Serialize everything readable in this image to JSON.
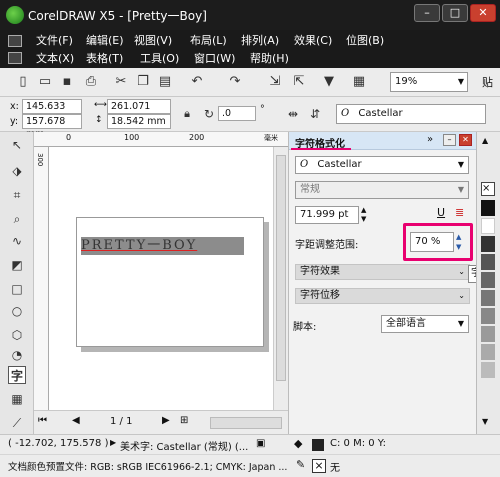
{
  "window": {
    "title": "CorelDRAW X5 - [Pretty一Boy]",
    "min": "–",
    "max": "□",
    "close": "✕"
  },
  "menu": {
    "row1": [
      "文件(F)",
      "编辑(E)",
      "视图(V)",
      "布局(L)",
      "排列(A)",
      "效果(C)",
      "位图(B)"
    ],
    "row2": [
      "文本(X)",
      "表格(T)",
      "工具(O)",
      "窗口(W)",
      "帮助(H)"
    ]
  },
  "toolbar": {
    "zoom": "19%",
    "paste_label": "贴"
  },
  "property_bar": {
    "x": "x:",
    "y": "y:",
    "x_value": "145.633 mm",
    "y_value": "157.678 mm",
    "w_value": "261.071 mm",
    "h_value": "18.542 mm",
    "angle": ".0",
    "degree": "°",
    "font": "Castellar"
  },
  "ruler": {
    "t0": "0",
    "t100": "100",
    "t200": "200",
    "unit": "毫米",
    "l300": "300"
  },
  "canvas": {
    "text": "PRETTY一BOY"
  },
  "docker": {
    "title": "字符格式化",
    "font": "Castellar",
    "style": "常规",
    "size": "71.999 pt",
    "spacing_label": "字距调整范围:",
    "spacing_value": "70 %",
    "tooltip": "字距调",
    "section_effects": "字符效果",
    "section_shift": "字符位移",
    "script_label": "脚本:",
    "script_value": "全部语言"
  },
  "page_nav": {
    "pages": "1 / 1"
  },
  "status": {
    "coords": "( -12.702, 175.578 )",
    "object": "美术字: Castellar (常规) (...",
    "color_profile": "文档颜色预置文件: RGB: sRGB IEC61966-2.1; CMYK: Japan ...",
    "fill": "C: 0 M: 0 Y:",
    "outline": "无"
  },
  "colors": {
    "highlight": "#e8006f",
    "titlebar": "#1c1c1c",
    "docker_title": "#d7e6f5"
  }
}
